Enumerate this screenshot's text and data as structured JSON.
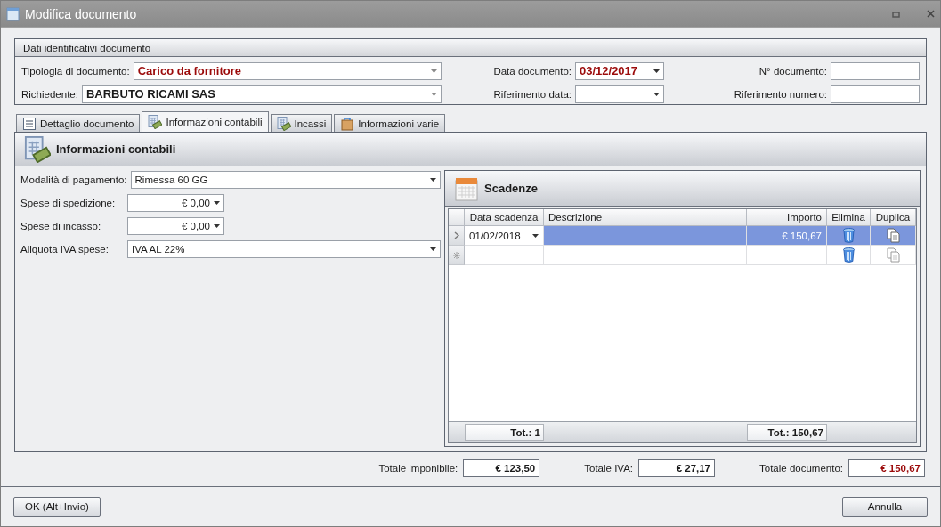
{
  "window": {
    "title": "Modifica documento"
  },
  "header_group": {
    "title": "Dati identificativi documento",
    "rows": [
      {
        "left": {
          "label": "Tipologia di documento:",
          "value": "Carico da fornitore"
        },
        "middle": {
          "label": "Data documento:",
          "value": "03/12/2017"
        },
        "right": {
          "label": "N° documento:"
        }
      },
      {
        "left": {
          "label": "Richiedente:",
          "value": "BARBUTO RICAMI SAS"
        },
        "middle": {
          "label": "Riferimento data:"
        },
        "right": {
          "label": "Riferimento numero:"
        }
      }
    ]
  },
  "tabs": [
    {
      "label": "Dettaglio documento",
      "selected": false
    },
    {
      "label": "Informazioni contabili",
      "selected": true
    },
    {
      "label": "Incassi",
      "selected": false
    },
    {
      "label": "Informazioni varie",
      "selected": false
    }
  ],
  "panel": {
    "title": "Informazioni contabili",
    "fields": [
      {
        "label": "Modalità di pagamento:",
        "value": "Rimessa 60 GG",
        "kind": "wide"
      },
      {
        "label": "Spese di spedizione:",
        "value": "€ 0,00",
        "kind": "amount"
      },
      {
        "label": "Spese di incasso:",
        "value": "€ 0,00",
        "kind": "amount"
      },
      {
        "label": "Aliquota IVA spese:",
        "value": "IVA AL 22%",
        "kind": "wide"
      }
    ],
    "schedule": {
      "title": "Scadenze",
      "columns": [
        "Data scadenza",
        "Descrizione",
        "Importo",
        "Elimina",
        "Duplica"
      ],
      "rows": [
        {
          "kind": "data",
          "selected": true,
          "date": "01/02/2018",
          "amount": "€ 150,67"
        },
        {
          "kind": "new",
          "selected": false
        }
      ],
      "footer": {
        "count": "Tot.: 1",
        "total": "Tot.: 150,67"
      }
    }
  },
  "totals": [
    {
      "label": "Totale imponibile:",
      "value": "€ 123,50"
    },
    {
      "label": "Totale IVA:",
      "value": "€ 27,17"
    },
    {
      "label": "Totale documento:",
      "value": "€ 150,67"
    }
  ],
  "buttons": {
    "ok": "OK (Alt+Invio)",
    "cancel": "Annulla"
  }
}
